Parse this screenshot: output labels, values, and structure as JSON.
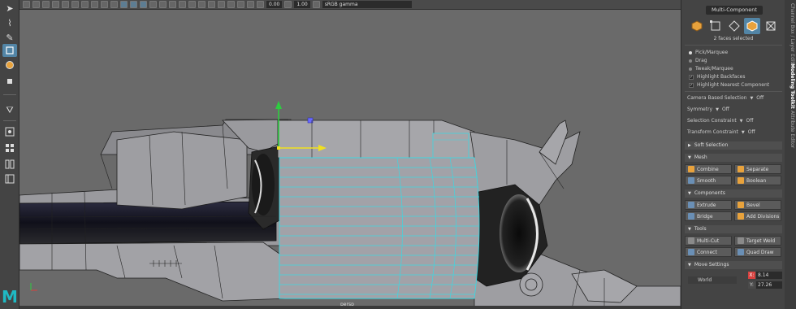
{
  "toolbar": {
    "field_a": "0.00",
    "field_b": "1.00",
    "colorspace": "sRGB gamma"
  },
  "viewport": {
    "camera_label": "persp"
  },
  "toolkit": {
    "mode_title": "Multi-Component",
    "selection_status": "2 faces selected",
    "pick_modes": [
      {
        "label": "Pick/Marquee",
        "selected": true
      },
      {
        "label": "Drag",
        "selected": false
      },
      {
        "label": "Tweak/Marquee",
        "selected": false
      }
    ],
    "highlights": [
      {
        "label": "Highlight Backfaces",
        "checked": true
      },
      {
        "label": "Highlight Nearest Component",
        "checked": true
      }
    ],
    "options": [
      {
        "label": "Camera Based Selection",
        "value": "Off"
      },
      {
        "label": "Symmetry",
        "value": "Off"
      },
      {
        "label": "Selection Constraint",
        "value": "Off"
      },
      {
        "label": "Transform Constraint",
        "value": "Off"
      }
    ],
    "soft_selection": "Soft Selection",
    "mesh": {
      "title": "Mesh",
      "buttons": [
        "Combine",
        "Separate",
        "Smooth",
        "Boolean"
      ]
    },
    "components": {
      "title": "Components",
      "buttons": [
        "Extrude",
        "Bevel",
        "Bridge",
        "Add Divisions"
      ]
    },
    "tools": {
      "title": "Tools",
      "buttons": [
        "Multi-Cut",
        "Target Weld",
        "Connect",
        "Quad Draw"
      ]
    },
    "move_settings": {
      "title": "Move Settings",
      "space": "World",
      "x_label": "X:",
      "x_value": "8.14",
      "y_label": "Y:",
      "y_value": "27.26"
    }
  },
  "side_tabs": [
    "Channel Box / Layer Editor",
    "Modeling Toolkit",
    "Attribute Editor"
  ],
  "colors": {
    "accent": "#5285a6",
    "wire_selected": "#3fd6e0",
    "gizmo_y": "#2ecc40",
    "gizmo_x": "#f0e020",
    "x_field": "#d8413f"
  }
}
